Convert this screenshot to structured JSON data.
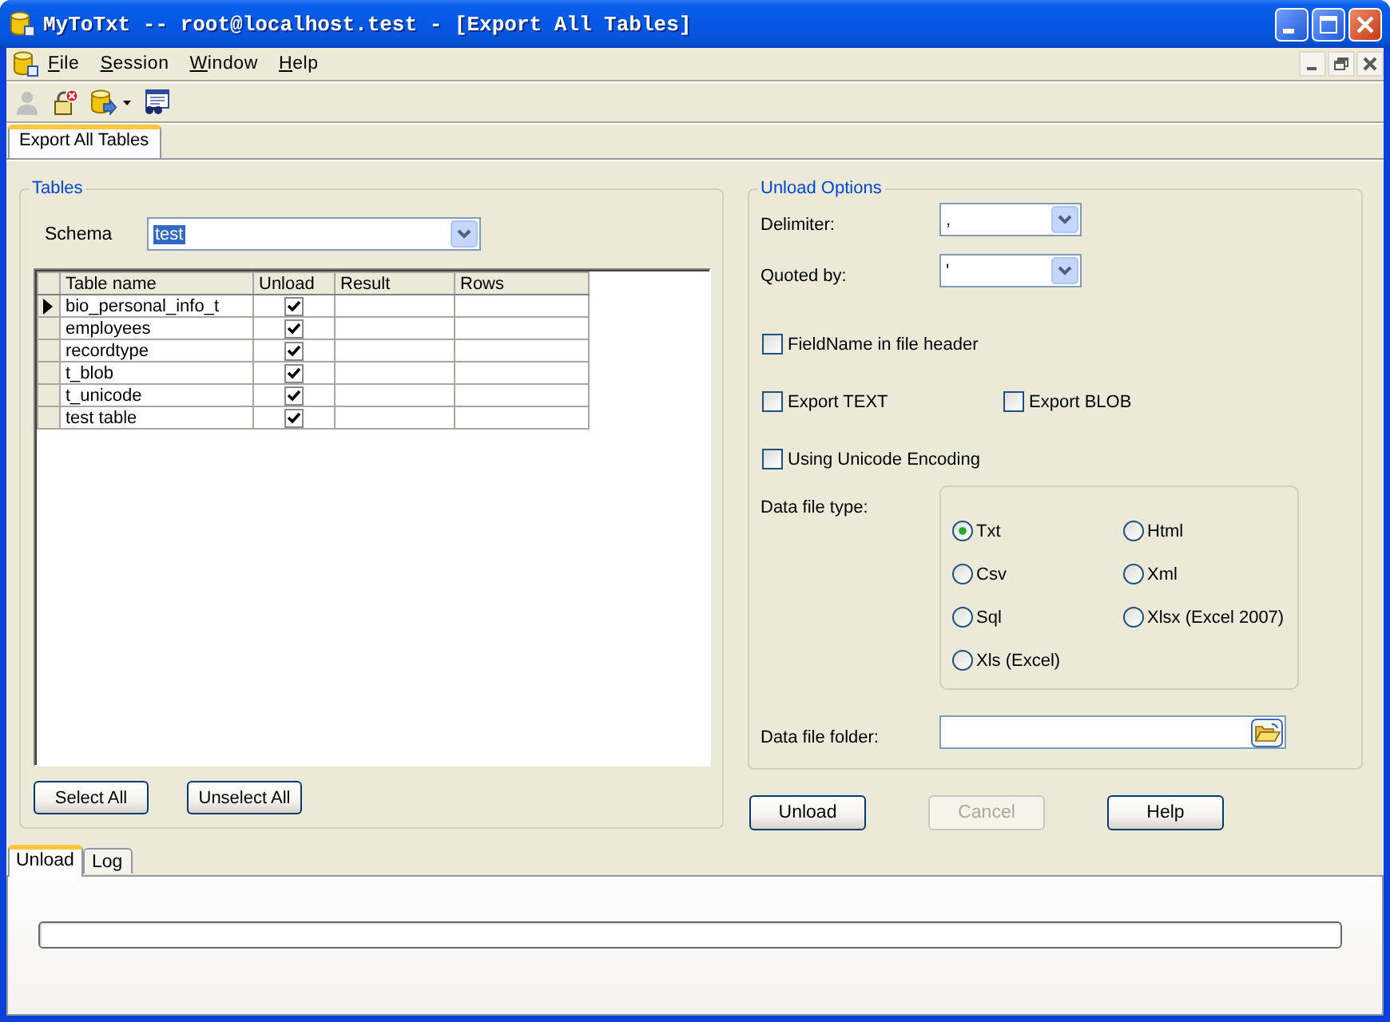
{
  "window": {
    "title": "MyToTxt -- root@localhost.test - [Export All Tables]"
  },
  "menu": [
    {
      "label": "File"
    },
    {
      "label": "Session"
    },
    {
      "label": "Window"
    },
    {
      "label": "Help"
    }
  ],
  "toolbar": [
    {
      "kind": "person",
      "disabled": true,
      "dropdown": false
    },
    {
      "kind": "lock",
      "disabled": false,
      "dropdown": false
    },
    {
      "kind": "database",
      "disabled": false,
      "dropdown": true
    },
    {
      "kind": "report",
      "disabled": false,
      "dropdown": false
    }
  ],
  "document_tabs": [
    {
      "label": "Export All Tables",
      "selected": true
    }
  ],
  "tables": {
    "title": "Tables",
    "schema": {
      "label": "Schema",
      "value": "test",
      "highlighted": true
    },
    "columns": [
      "Table name",
      "Unload",
      "Result",
      "Rows"
    ],
    "rows": [
      {
        "name": "bio_personal_info_t",
        "unload": true,
        "selected": true
      },
      {
        "name": "employees",
        "unload": true,
        "selected": false
      },
      {
        "name": "recordtype",
        "unload": true,
        "selected": false
      },
      {
        "name": "t_blob",
        "unload": true,
        "selected": false
      },
      {
        "name": "t_unicode",
        "unload": true,
        "selected": false
      },
      {
        "name": "test table",
        "unload": true,
        "selected": false
      }
    ],
    "buttons": [
      {
        "label": "Select All"
      },
      {
        "label": "Unselect All"
      }
    ]
  },
  "unload_options": {
    "title": "Unload Options",
    "delimiter": {
      "label": "Delimiter:",
      "value": ","
    },
    "quoted_by": {
      "label": "Quoted by:",
      "value": "'"
    },
    "checkbox_rows": [
      {
        "items": [
          {
            "label": "FieldName in file header",
            "checked": false
          }
        ]
      },
      {
        "items": [
          {
            "label": "Export TEXT",
            "checked": false
          },
          {
            "label": "Export BLOB",
            "checked": false
          }
        ]
      },
      {
        "items": [
          {
            "label": "Using Unicode Encoding",
            "checked": false
          }
        ]
      }
    ],
    "data_file_type": {
      "label": "Data file type:",
      "options": [
        {
          "label": "Txt",
          "selected": true
        },
        {
          "label": "Html",
          "selected": false
        },
        {
          "label": "Csv",
          "selected": false
        },
        {
          "label": "Xml",
          "selected": false
        },
        {
          "label": "Sql",
          "selected": false
        },
        {
          "label": "Xlsx (Excel 2007)",
          "selected": false
        },
        {
          "label": "Xls (Excel)",
          "selected": false
        }
      ]
    },
    "data_file_folder": {
      "label": "Data file folder:"
    }
  },
  "actions": [
    {
      "label": "Unload",
      "disabled": false
    },
    {
      "label": "Cancel",
      "disabled": true
    },
    {
      "label": "Help",
      "disabled": false
    }
  ],
  "bottom_tabs": [
    {
      "label": "Unload",
      "selected": true
    },
    {
      "label": "Log",
      "selected": false
    }
  ],
  "progress": {
    "level": 0
  }
}
